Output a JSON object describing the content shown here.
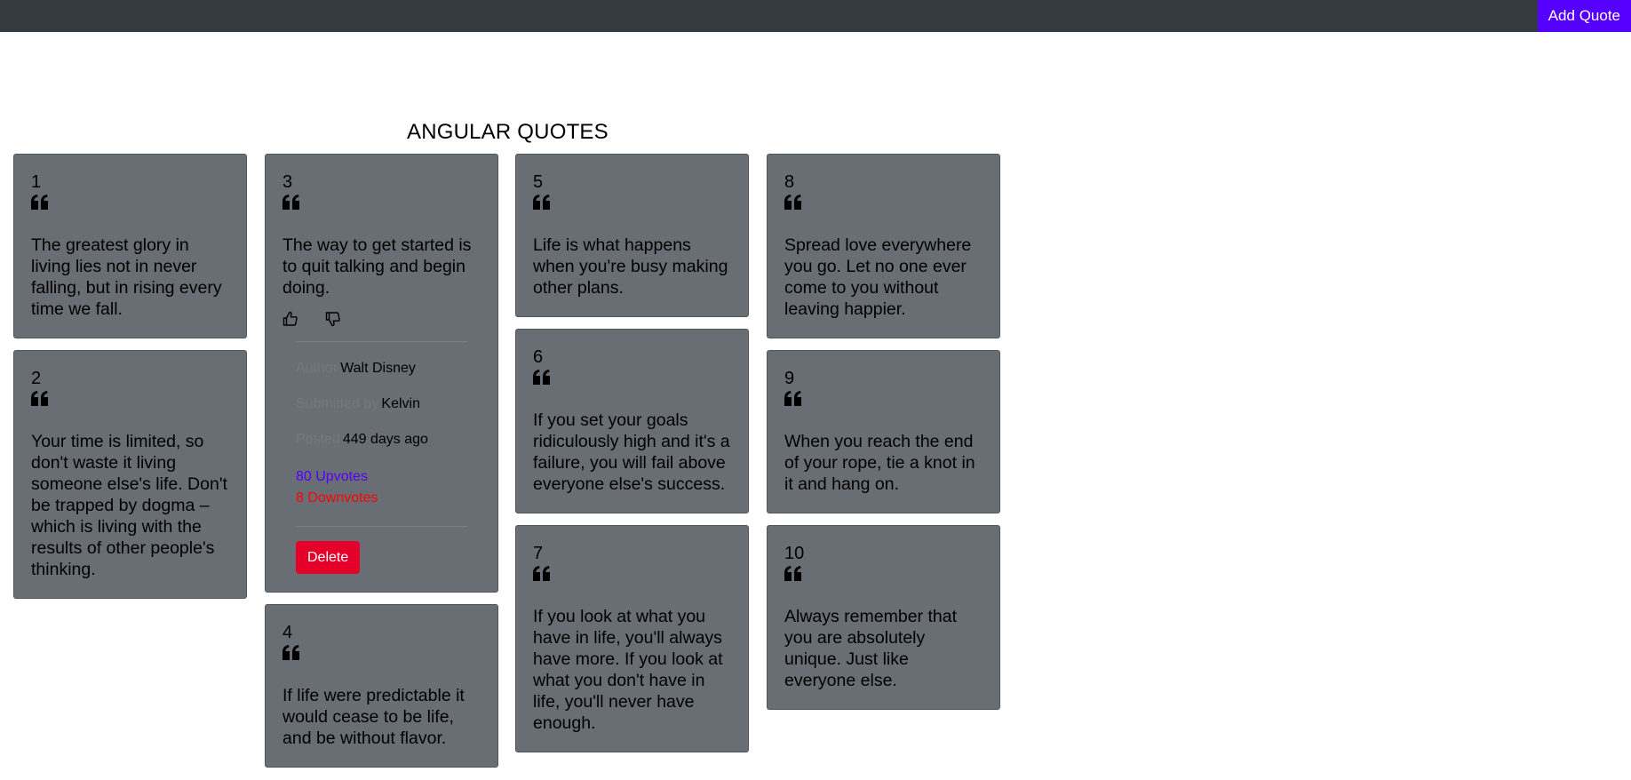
{
  "navbar": {
    "add_quote_label": "Add Quote"
  },
  "page": {
    "title": "ANGULAR QUOTES"
  },
  "quotes": [
    {
      "number": "1",
      "text": "The greatest glory in living lies not in never falling, but in rising every time we fall."
    },
    {
      "number": "2",
      "text": "Your time is limited, so don't waste it living someone else's life. Don't be trapped by dogma – which is living with the results of other people's thinking."
    },
    {
      "number": "3",
      "text": "The way to get started is to quit talking and begin doing.",
      "details": {
        "author_label": "Author",
        "author": "Walt Disney",
        "submitted_label": "Submitted by",
        "submitted_by": "Kelvin",
        "posted_label": "Posted",
        "posted": "449 days ago",
        "upvotes": "80 Upvotes",
        "downvotes": "8 Downvotes",
        "delete_label": "Delete"
      }
    },
    {
      "number": "4",
      "text": "If life were predictable it would cease to be life, and be without flavor."
    },
    {
      "number": "5",
      "text": "Life is what happens when you're busy making other plans."
    },
    {
      "number": "6",
      "text": "If you set your goals ridiculously high and it's a failure, you will fail above everyone else's success."
    },
    {
      "number": "7",
      "text": "If you look at what you have in life, you'll always have more. If you look at what you don't have in life, you'll never have enough."
    },
    {
      "number": "8",
      "text": "Spread love everywhere you go. Let no one ever come to you without leaving happier."
    },
    {
      "number": "9",
      "text": "When you reach the end of your rope, tie a knot in it and hang on."
    },
    {
      "number": "10",
      "text": "Always remember that you are absolutely unique. Just like everyone else."
    }
  ],
  "icons": {
    "quote": "quote-left-icon",
    "upvote": "thumbs-up-icon",
    "downvote": "thumbs-down-icon"
  },
  "colors": {
    "navbar": "#343a40",
    "accent": "#5500ff",
    "card": "#686e74",
    "upvotes": "#5500ff",
    "downvotes": "#ff0000",
    "delete": "#e4002b"
  }
}
